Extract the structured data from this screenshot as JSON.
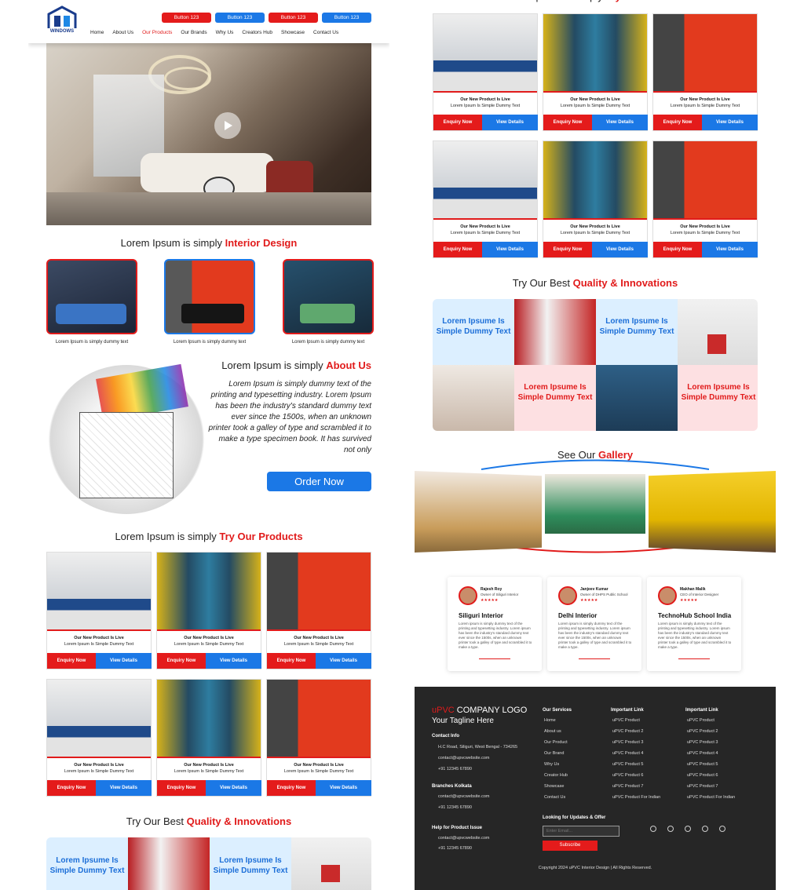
{
  "header": {
    "logo_text": "WINDOWS",
    "buttons": [
      "Button 123",
      "Button 123",
      "Button 123",
      "Button 123"
    ],
    "nav": [
      "Home",
      "About Us",
      "Our Products",
      "Our Brands",
      "Why Us",
      "Creators Hub",
      "Showcase",
      "Contact Us"
    ]
  },
  "interior": {
    "title_plain": "Lorem Ipsum is simply ",
    "title_accent": "Interior Design",
    "captions": [
      "Lorem Ipsum is simply dummy text",
      "Lorem Ipsum is simply dummy text",
      "Lorem Ipsum is simply dummy text"
    ]
  },
  "about": {
    "title_plain": "Lorem Ipsum is simply ",
    "title_accent": "About Us",
    "text": "Lorem Ipsum is simply dummy text of the printing and typesetting industry. Lorem Ipsum has been the industry's standard dummy text ever since the 1500s, when an unknown printer took a galley of type and scrambled it to make a type specimen book. It has survived not only",
    "button": "Order Now"
  },
  "products": {
    "title_plain": "Lorem Ipsum is simply ",
    "title_accent": "Try Our Products",
    "card_title": "Our New Product Is Live",
    "card_sub": "Lorem Ipsum Is Simple Dummy Text",
    "enquiry": "Enquiry Now",
    "view": "View Details"
  },
  "quality": {
    "title_plain": "Try Our Best ",
    "title_accent": "Quality & Innovations",
    "tile_text": "Lorem Ipsume Is Simple Dummy Text"
  },
  "gallery": {
    "title_plain": "See Our ",
    "title_accent": "Gallery"
  },
  "testimonials": [
    {
      "name": "Rajesh Roy",
      "role": "Owner of Siliguri Interior",
      "title": "Siliguri Interior"
    },
    {
      "name": "Janjeev Kumar",
      "role": "Owner of DHPS Public School",
      "title": "Delhi Interior"
    },
    {
      "name": "Makhan Malik",
      "role": "CEO of Interior Designer",
      "title": "TechnoHub School India"
    }
  ],
  "testimonial_body": "Lorem ipsum is simply dummy text of the printing and typesetting industry. Lorem ipsum has been the industry's standard dummy text ever since the 1500s, when an unknown printer took a galley of type and scrambled it to make a type.",
  "footer": {
    "logo_accent": "uPVC",
    "logo_plain": " COMPANY LOGO",
    "tagline": "Your Tagline Here",
    "contact_h": "Contact Info",
    "address": "H.C Road, Siliguri, West Bengal - 734265",
    "email": "contact@upvcwebsite.com",
    "phone": "+91 12345 67890",
    "branches_h": "Branches Kolkata",
    "help_h": "Help for Product Issue",
    "services_h": "Our Services",
    "services": [
      "Home",
      "About us",
      "Our Product",
      "Our Brand",
      "Why Us",
      "Creator Hub",
      "Showcase",
      "Contact Us"
    ],
    "important_h": "Important Link",
    "important1": [
      "uPVC Product",
      "uPVC Product 2",
      "uPVC Product 3",
      "uPVC Product 4",
      "uPVC Product 5",
      "uPVC Product 6",
      "uPVC Product 7",
      "uPVC Product For Indian"
    ],
    "important2": [
      "uPVC Product",
      "uPVC Product 2",
      "uPVC Product 3",
      "uPVC Product 4",
      "uPVC Product 5",
      "uPVC Product 6",
      "uPVC Product 7",
      "uPVC Product For Indian"
    ],
    "newsletter_h": "Looking for Updates & Offer",
    "email_placeholder": "Enter Email...",
    "subscribe": "Subscribe",
    "copyright": "Copyright 2024 uPVC Interior Design | All Rights Reserved."
  }
}
